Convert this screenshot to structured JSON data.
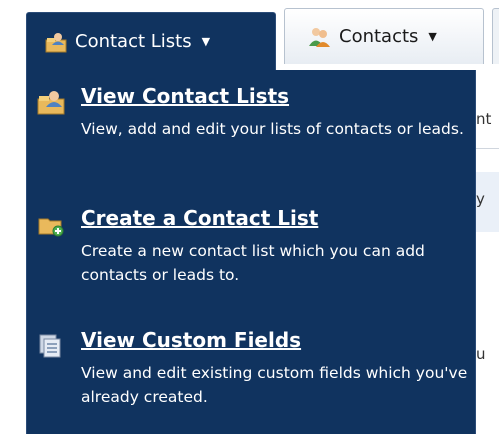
{
  "tabs": {
    "contact_lists": {
      "label": "Contact Lists"
    },
    "contacts": {
      "label": "Contacts"
    }
  },
  "menu": {
    "items": [
      {
        "title": "View Contact Lists",
        "description": "View, add and edit your lists of contacts or leads.",
        "icon": "contact-list-icon"
      },
      {
        "title": "Create a Contact List",
        "description": "Create a new contact list which you can add contacts or leads to.",
        "icon": "folder-add-icon"
      },
      {
        "title": "View Custom Fields",
        "description": "View and edit existing custom fields which you've already created.",
        "icon": "custom-fields-icon"
      }
    ]
  },
  "background_fragments": [
    "nt",
    "y",
    "u"
  ],
  "colors": {
    "menu_bg": "#10335f",
    "text": "#ffffff"
  }
}
